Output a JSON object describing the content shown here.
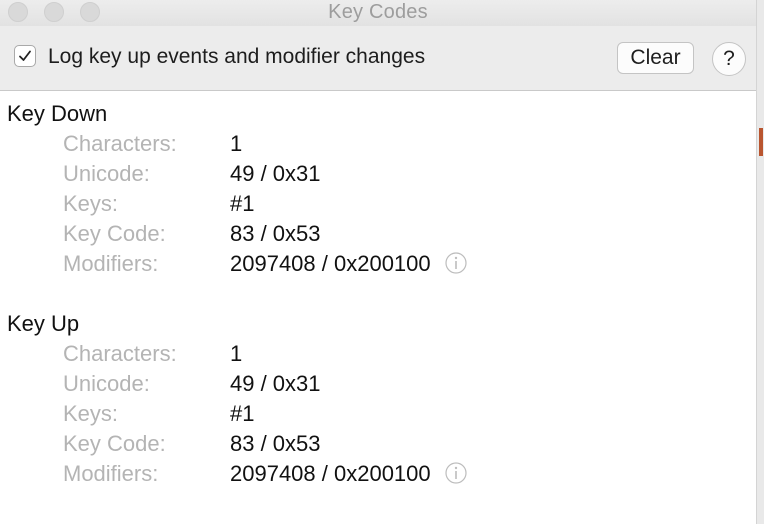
{
  "window": {
    "title": "Key Codes"
  },
  "toolbar": {
    "log_checkbox_checked": true,
    "log_checkbox_label": "Log key up events and modifier changes",
    "clear_label": "Clear",
    "help_label": "?"
  },
  "key_down": {
    "title": "Key Down",
    "fields": [
      {
        "label": "Characters:",
        "value": "1"
      },
      {
        "label": "Unicode:",
        "value": "49 / 0x31"
      },
      {
        "label": "Keys:",
        "value": "#1"
      },
      {
        "label": "Key Code:",
        "value": "83 / 0x53"
      },
      {
        "label": "Modifiers:",
        "value": "2097408 / 0x200100"
      }
    ]
  },
  "key_up": {
    "title": "Key Up",
    "fields": [
      {
        "label": "Characters:",
        "value": "1"
      },
      {
        "label": "Unicode:",
        "value": "49 / 0x31"
      },
      {
        "label": "Keys:",
        "value": "#1"
      },
      {
        "label": "Key Code:",
        "value": "83 / 0x53"
      },
      {
        "label": "Modifiers:",
        "value": "2097408 / 0x200100"
      }
    ]
  }
}
